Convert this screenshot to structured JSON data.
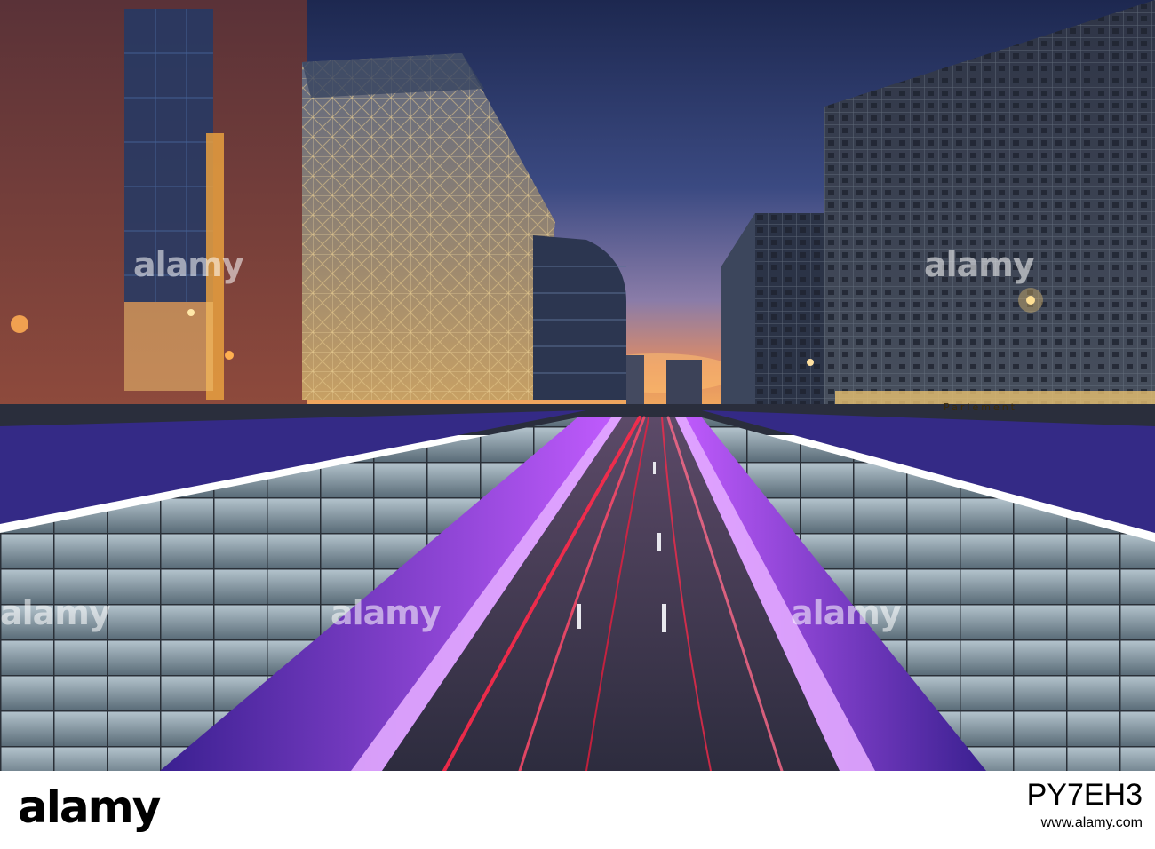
{
  "photo": {
    "watermark_text": "alamy",
    "building_sign": "Parlement"
  },
  "footer": {
    "logo": "alamy",
    "image_id": "PY7EH3",
    "url": "www.alamy.com"
  },
  "colors": {
    "sky_top": "#26325c",
    "sky_horizon": "#f3a45a",
    "tunnel_light": "#b145ff",
    "tail_lights": "#ff2a4a"
  }
}
